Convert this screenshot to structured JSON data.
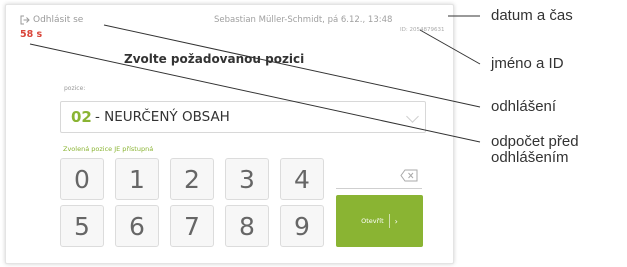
{
  "header": {
    "logout_label": "Odhlásit se",
    "user_info": "Sebastian Müller-Schmidt, pá 6.12., 13:48",
    "user_id": "ID: 2054879631",
    "timer": "58 s"
  },
  "main": {
    "title": "Zvolte požadovanou pozici",
    "field_label": "pozice:",
    "selected_number": "02",
    "selected_text": "- NEURČENÝ OBSAH",
    "status": "Zvolená pozice JE přístupná"
  },
  "keypad": {
    "row1": [
      "0",
      "1",
      "2",
      "3",
      "4"
    ],
    "row2": [
      "5",
      "6",
      "7",
      "8",
      "9"
    ]
  },
  "open_button": {
    "label": "Otevřít",
    "arrow": "›"
  },
  "annotations": {
    "datum": "datum a čas",
    "jmeno": "jméno a ID",
    "odhlaseni": "odhlášení",
    "odpocet_line1": "odpočet před",
    "odpocet_line2": "odhlášením"
  },
  "colors": {
    "accent": "#8ab433",
    "timer": "#d9453a"
  },
  "icons": {
    "logout": "logout-icon",
    "backspace": "backspace-icon",
    "chevron": "chevron-down-icon"
  }
}
